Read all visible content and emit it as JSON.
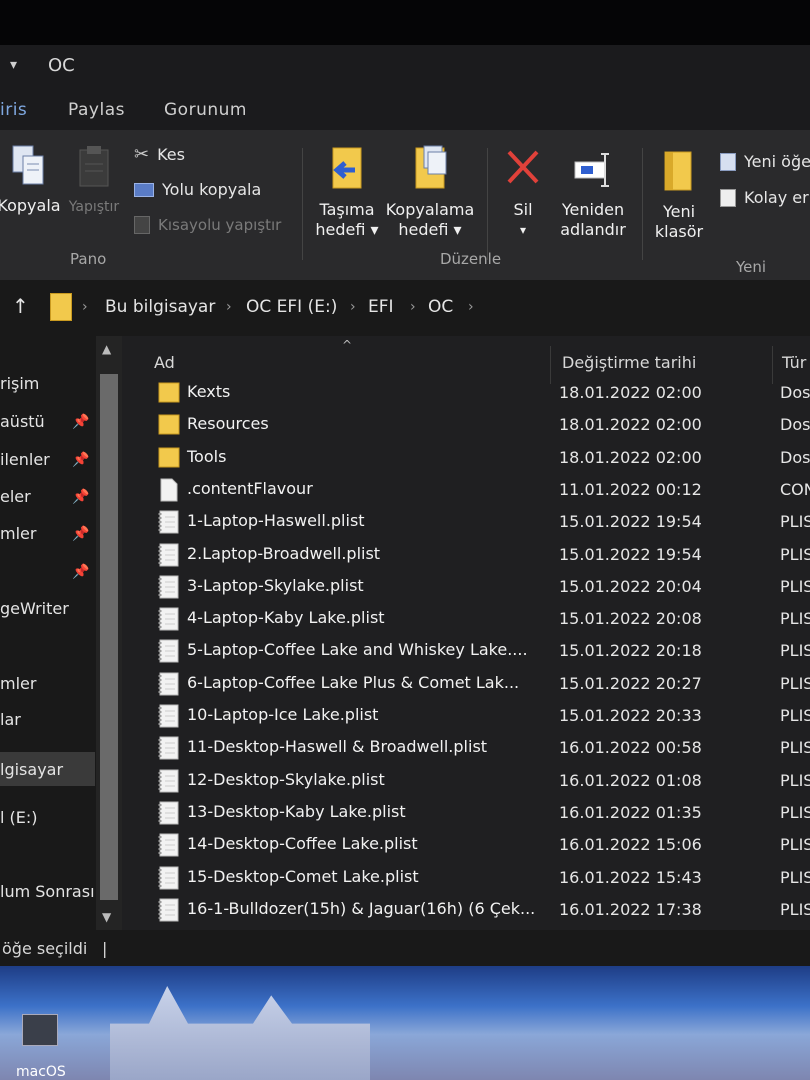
{
  "window": {
    "title": "OC",
    "quick_access": "▾"
  },
  "tabs": [
    "iris",
    "Paylas",
    "Gorunum"
  ],
  "ribbon": {
    "pano": {
      "group_label": "Pano",
      "copy_label": "Kopyala",
      "paste_label": "Yapıştır",
      "cut_label": "Kes",
      "copy_path_label": "Yolu kopyala",
      "paste_shortcut_label": "Kısayolu yapıştır"
    },
    "duzenle": {
      "group_label": "Düzenle",
      "move_to_label": [
        "Taşıma",
        "hedefi ▾"
      ],
      "copy_to_label": [
        "Kopyalama",
        "hedefi ▾"
      ],
      "delete_label": [
        "Sil",
        "▾"
      ],
      "rename_label": [
        "Yeniden",
        "adlandır"
      ]
    },
    "yeni": {
      "group_label": "Yeni",
      "new_folder_label": [
        "Yeni",
        "klasör"
      ],
      "new_item_label": "Yeni öğe",
      "easy_access_label": "Kolay er"
    }
  },
  "address_bar": {
    "up_arrow": "↑",
    "crumbs": [
      "Bu bilgisayar",
      "OC EFI (E:)",
      "EFI",
      "OC"
    ]
  },
  "nav_pane": {
    "items": [
      "rişim",
      "aüstü",
      "ilenler",
      "eler",
      "mler",
      "geWriter",
      "mler",
      "lar",
      "lgisayar",
      "l (E:)",
      "lum Sonrası"
    ],
    "pin_glyph": "📌"
  },
  "columns": {
    "name": "Ad",
    "date": "Değiştirme tarihi",
    "type": "Tür"
  },
  "files": [
    {
      "name": "Kexts",
      "date": "18.01.2022 02:00",
      "type": "Dos",
      "icon": "folder-icon"
    },
    {
      "name": "Resources",
      "date": "18.01.2022 02:00",
      "type": "Dos",
      "icon": "folder-icon"
    },
    {
      "name": "Tools",
      "date": "18.01.2022 02:00",
      "type": "Dos",
      "icon": "folder-icon"
    },
    {
      "name": ".contentFlavour",
      "date": "11.01.2022 00:12",
      "type": "CON",
      "icon": "file-icon"
    },
    {
      "name": "1-Laptop-Haswell.plist",
      "date": "15.01.2022 19:54",
      "type": "PLIS",
      "icon": "plist-icon"
    },
    {
      "name": "2.Laptop-Broadwell.plist",
      "date": "15.01.2022 19:54",
      "type": "PLIS",
      "icon": "plist-icon"
    },
    {
      "name": "3-Laptop-Skylake.plist",
      "date": "15.01.2022 20:04",
      "type": "PLIS",
      "icon": "plist-icon"
    },
    {
      "name": "4-Laptop-Kaby Lake.plist",
      "date": "15.01.2022 20:08",
      "type": "PLIS",
      "icon": "plist-icon"
    },
    {
      "name": "5-Laptop-Coffee Lake and Whiskey Lake....",
      "date": "15.01.2022 20:18",
      "type": "PLIS",
      "icon": "plist-icon"
    },
    {
      "name": "6-Laptop-Coffee Lake Plus & Comet Lak...",
      "date": "15.01.2022 20:27",
      "type": "PLIS",
      "icon": "plist-icon"
    },
    {
      "name": "10-Laptop-Ice Lake.plist",
      "date": "15.01.2022 20:33",
      "type": "PLIS",
      "icon": "plist-icon"
    },
    {
      "name": "11-Desktop-Haswell & Broadwell.plist",
      "date": "16.01.2022 00:58",
      "type": "PLIS",
      "icon": "plist-icon"
    },
    {
      "name": "12-Desktop-Skylake.plist",
      "date": "16.01.2022 01:08",
      "type": "PLIST",
      "icon": "plist-icon"
    },
    {
      "name": "13-Desktop-Kaby Lake.plist",
      "date": "16.01.2022 01:35",
      "type": "PLIST",
      "icon": "plist-icon"
    },
    {
      "name": "14-Desktop-Coffee Lake.plist",
      "date": "16.01.2022 15:06",
      "type": "PLIST",
      "icon": "plist-icon"
    },
    {
      "name": "15-Desktop-Comet Lake.plist",
      "date": "16.01.2022 15:43",
      "type": "PLIST",
      "icon": "plist-icon"
    },
    {
      "name": "16-1-Bulldozer(15h) & Jaguar(16h) (6 Çek...",
      "date": "16.01.2022 17:38",
      "type": "PLIST",
      "icon": "plist-icon"
    }
  ],
  "status_bar": {
    "selection_text": "öğe seçildi",
    "divider": "|"
  },
  "desktop": {
    "icon_label": "macOS"
  },
  "colors": {
    "folder": "#f2c94c",
    "accent": "#7fa8e0",
    "delete": "#e0413a",
    "row_text": "#f2f2f2"
  }
}
